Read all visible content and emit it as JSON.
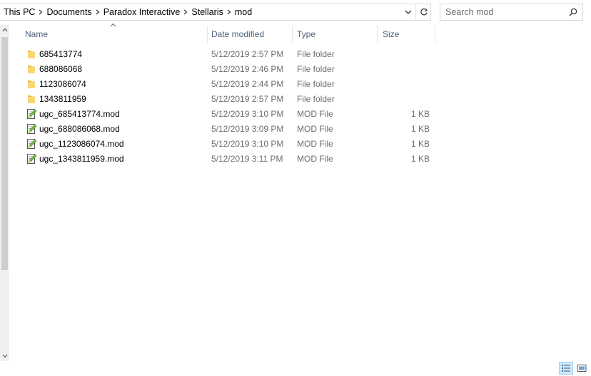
{
  "breadcrumb": [
    "This PC",
    "Documents",
    "Paradox Interactive",
    "Stellaris",
    "mod"
  ],
  "search": {
    "placeholder": "Search mod"
  },
  "columns": {
    "name": "Name",
    "date": "Date modified",
    "type": "Type",
    "size": "Size"
  },
  "files": [
    {
      "name": "685413774",
      "date": "5/12/2019 2:57 PM",
      "type": "File folder",
      "size": "",
      "icon": "folder-icon"
    },
    {
      "name": "688086068",
      "date": "5/12/2019 2:46 PM",
      "type": "File folder",
      "size": "",
      "icon": "folder-icon"
    },
    {
      "name": "1123086074",
      "date": "5/12/2019 2:44 PM",
      "type": "File folder",
      "size": "",
      "icon": "folder-icon"
    },
    {
      "name": "1343811959",
      "date": "5/12/2019 2:57 PM",
      "type": "File folder",
      "size": "",
      "icon": "folder-icon"
    },
    {
      "name": "ugc_685413774.mod",
      "date": "5/12/2019 3:10 PM",
      "type": "MOD File",
      "size": "1 KB",
      "icon": "mod-file-icon"
    },
    {
      "name": "ugc_688086068.mod",
      "date": "5/12/2019 3:09 PM",
      "type": "MOD File",
      "size": "1 KB",
      "icon": "mod-file-icon"
    },
    {
      "name": "ugc_1123086074.mod",
      "date": "5/12/2019 3:10 PM",
      "type": "MOD File",
      "size": "1 KB",
      "icon": "mod-file-icon"
    },
    {
      "name": "ugc_1343811959.mod",
      "date": "5/12/2019 3:11 PM",
      "type": "MOD File",
      "size": "1 KB",
      "icon": "mod-file-icon"
    }
  ],
  "colors": {
    "header_text": "#4c607a",
    "secondary_text": "#6d6d6d",
    "folder": "#f8d775",
    "selected_view": "#cce8ff"
  }
}
